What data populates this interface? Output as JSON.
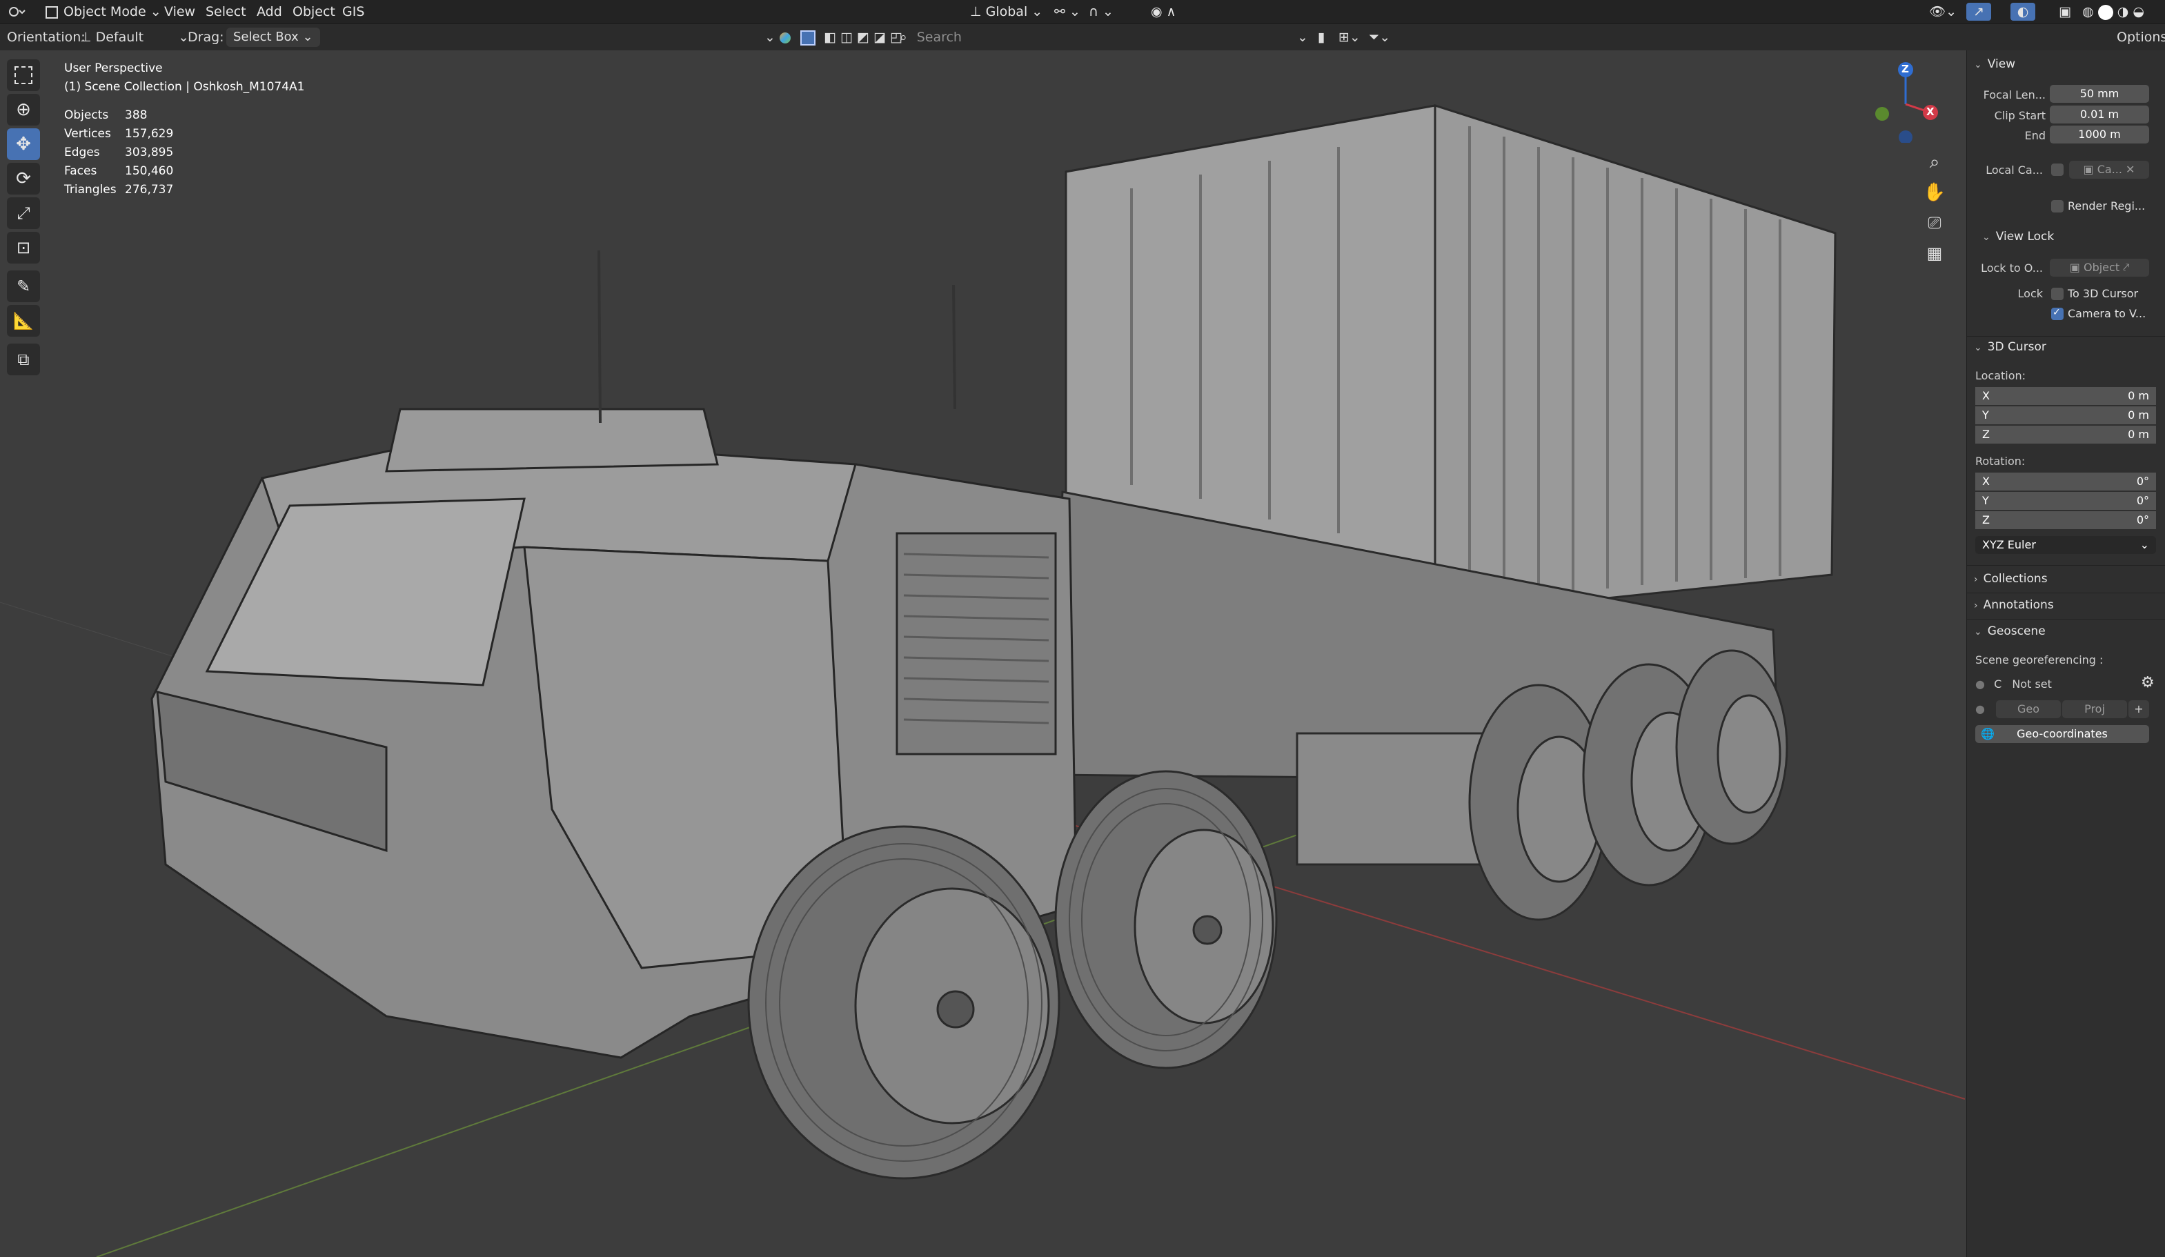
{
  "header": {
    "mode": "Object Mode",
    "menus": [
      "View",
      "Select",
      "Add",
      "Object",
      "GIS"
    ],
    "transform_orientation": "Global"
  },
  "tool_settings": {
    "orientation_label": "Orientation:",
    "orientation_value": "Default",
    "drag_label": "Drag:",
    "drag_value": "Select Box",
    "search_placeholder": "Search",
    "options_label": "Options"
  },
  "viewport": {
    "view_name": "User Perspective",
    "collection": "(1) Scene Collection | Oshkosh_M1074A1",
    "stats": [
      {
        "label": "Objects",
        "value": "388"
      },
      {
        "label": "Vertices",
        "value": "157,629"
      },
      {
        "label": "Edges",
        "value": "303,895"
      },
      {
        "label": "Faces",
        "value": "150,460"
      },
      {
        "label": "Triangles",
        "value": "276,737"
      }
    ],
    "gizmo_axes": [
      "Z",
      "X"
    ]
  },
  "sidebar": {
    "view": {
      "title": "View",
      "focal_length_label": "Focal Len...",
      "focal_length_value": "50 mm",
      "clip_start_label": "Clip Start",
      "clip_start_value": "0.01 m",
      "end_label": "End",
      "end_value": "1000 m",
      "local_camera_label": "Local Ca...",
      "local_camera_value": "Ca...",
      "render_region_label": "Render Regi...",
      "view_lock_title": "View Lock",
      "lock_to_object_label": "Lock to O...",
      "lock_to_object_placeholder": "Object",
      "lock_label": "Lock",
      "to_3d_cursor_label": "To 3D Cursor",
      "camera_to_view_label": "Camera to V..."
    },
    "cursor": {
      "title": "3D Cursor",
      "location_label": "Location:",
      "location": [
        {
          "axis": "X",
          "value": "0 m"
        },
        {
          "axis": "Y",
          "value": "0 m"
        },
        {
          "axis": "Z",
          "value": "0 m"
        }
      ],
      "rotation_label": "Rotation:",
      "rotation": [
        {
          "axis": "X",
          "value": "0°"
        },
        {
          "axis": "Y",
          "value": "0°"
        },
        {
          "axis": "Z",
          "value": "0°"
        }
      ],
      "rotation_mode": "XYZ Euler"
    },
    "collections_title": "Collections",
    "annotations_title": "Annotations",
    "geoscene": {
      "title": "Geoscene",
      "georef_label": "Scene georeferencing :",
      "crs_prefix": "C",
      "crs_value": "Not set",
      "geo_button": "Geo",
      "proj_button": "Proj",
      "geo_coordinates_button": "Geo-coordinates"
    }
  }
}
